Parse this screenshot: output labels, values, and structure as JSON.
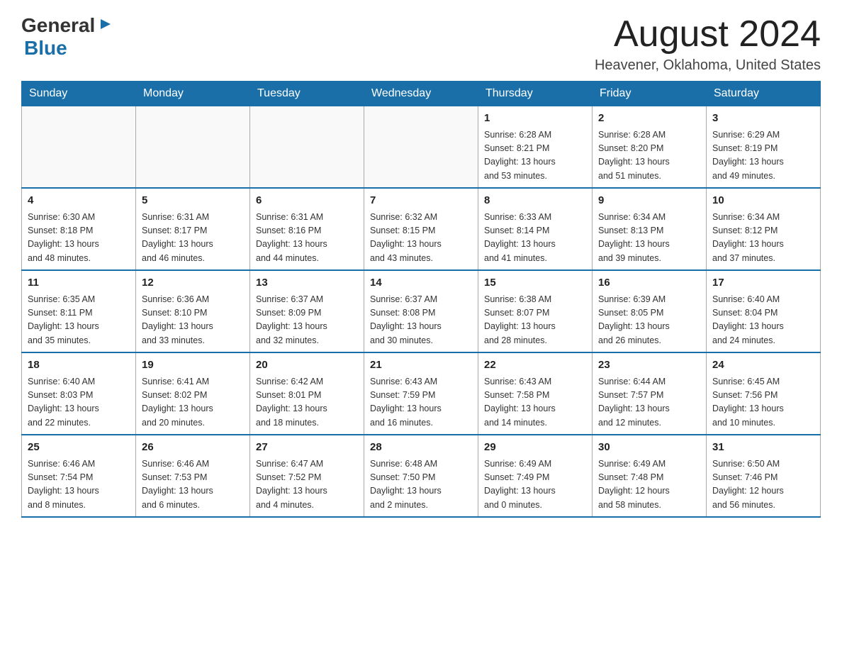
{
  "header": {
    "logo": {
      "general": "General",
      "blue": "Blue",
      "arrow": "▶"
    },
    "title": "August 2024",
    "location": "Heavener, Oklahoma, United States"
  },
  "calendar": {
    "days_of_week": [
      "Sunday",
      "Monday",
      "Tuesday",
      "Wednesday",
      "Thursday",
      "Friday",
      "Saturday"
    ],
    "weeks": [
      [
        {
          "day": "",
          "info": ""
        },
        {
          "day": "",
          "info": ""
        },
        {
          "day": "",
          "info": ""
        },
        {
          "day": "",
          "info": ""
        },
        {
          "day": "1",
          "info": "Sunrise: 6:28 AM\nSunset: 8:21 PM\nDaylight: 13 hours\nand 53 minutes."
        },
        {
          "day": "2",
          "info": "Sunrise: 6:28 AM\nSunset: 8:20 PM\nDaylight: 13 hours\nand 51 minutes."
        },
        {
          "day": "3",
          "info": "Sunrise: 6:29 AM\nSunset: 8:19 PM\nDaylight: 13 hours\nand 49 minutes."
        }
      ],
      [
        {
          "day": "4",
          "info": "Sunrise: 6:30 AM\nSunset: 8:18 PM\nDaylight: 13 hours\nand 48 minutes."
        },
        {
          "day": "5",
          "info": "Sunrise: 6:31 AM\nSunset: 8:17 PM\nDaylight: 13 hours\nand 46 minutes."
        },
        {
          "day": "6",
          "info": "Sunrise: 6:31 AM\nSunset: 8:16 PM\nDaylight: 13 hours\nand 44 minutes."
        },
        {
          "day": "7",
          "info": "Sunrise: 6:32 AM\nSunset: 8:15 PM\nDaylight: 13 hours\nand 43 minutes."
        },
        {
          "day": "8",
          "info": "Sunrise: 6:33 AM\nSunset: 8:14 PM\nDaylight: 13 hours\nand 41 minutes."
        },
        {
          "day": "9",
          "info": "Sunrise: 6:34 AM\nSunset: 8:13 PM\nDaylight: 13 hours\nand 39 minutes."
        },
        {
          "day": "10",
          "info": "Sunrise: 6:34 AM\nSunset: 8:12 PM\nDaylight: 13 hours\nand 37 minutes."
        }
      ],
      [
        {
          "day": "11",
          "info": "Sunrise: 6:35 AM\nSunset: 8:11 PM\nDaylight: 13 hours\nand 35 minutes."
        },
        {
          "day": "12",
          "info": "Sunrise: 6:36 AM\nSunset: 8:10 PM\nDaylight: 13 hours\nand 33 minutes."
        },
        {
          "day": "13",
          "info": "Sunrise: 6:37 AM\nSunset: 8:09 PM\nDaylight: 13 hours\nand 32 minutes."
        },
        {
          "day": "14",
          "info": "Sunrise: 6:37 AM\nSunset: 8:08 PM\nDaylight: 13 hours\nand 30 minutes."
        },
        {
          "day": "15",
          "info": "Sunrise: 6:38 AM\nSunset: 8:07 PM\nDaylight: 13 hours\nand 28 minutes."
        },
        {
          "day": "16",
          "info": "Sunrise: 6:39 AM\nSunset: 8:05 PM\nDaylight: 13 hours\nand 26 minutes."
        },
        {
          "day": "17",
          "info": "Sunrise: 6:40 AM\nSunset: 8:04 PM\nDaylight: 13 hours\nand 24 minutes."
        }
      ],
      [
        {
          "day": "18",
          "info": "Sunrise: 6:40 AM\nSunset: 8:03 PM\nDaylight: 13 hours\nand 22 minutes."
        },
        {
          "day": "19",
          "info": "Sunrise: 6:41 AM\nSunset: 8:02 PM\nDaylight: 13 hours\nand 20 minutes."
        },
        {
          "day": "20",
          "info": "Sunrise: 6:42 AM\nSunset: 8:01 PM\nDaylight: 13 hours\nand 18 minutes."
        },
        {
          "day": "21",
          "info": "Sunrise: 6:43 AM\nSunset: 7:59 PM\nDaylight: 13 hours\nand 16 minutes."
        },
        {
          "day": "22",
          "info": "Sunrise: 6:43 AM\nSunset: 7:58 PM\nDaylight: 13 hours\nand 14 minutes."
        },
        {
          "day": "23",
          "info": "Sunrise: 6:44 AM\nSunset: 7:57 PM\nDaylight: 13 hours\nand 12 minutes."
        },
        {
          "day": "24",
          "info": "Sunrise: 6:45 AM\nSunset: 7:56 PM\nDaylight: 13 hours\nand 10 minutes."
        }
      ],
      [
        {
          "day": "25",
          "info": "Sunrise: 6:46 AM\nSunset: 7:54 PM\nDaylight: 13 hours\nand 8 minutes."
        },
        {
          "day": "26",
          "info": "Sunrise: 6:46 AM\nSunset: 7:53 PM\nDaylight: 13 hours\nand 6 minutes."
        },
        {
          "day": "27",
          "info": "Sunrise: 6:47 AM\nSunset: 7:52 PM\nDaylight: 13 hours\nand 4 minutes."
        },
        {
          "day": "28",
          "info": "Sunrise: 6:48 AM\nSunset: 7:50 PM\nDaylight: 13 hours\nand 2 minutes."
        },
        {
          "day": "29",
          "info": "Sunrise: 6:49 AM\nSunset: 7:49 PM\nDaylight: 13 hours\nand 0 minutes."
        },
        {
          "day": "30",
          "info": "Sunrise: 6:49 AM\nSunset: 7:48 PM\nDaylight: 12 hours\nand 58 minutes."
        },
        {
          "day": "31",
          "info": "Sunrise: 6:50 AM\nSunset: 7:46 PM\nDaylight: 12 hours\nand 56 minutes."
        }
      ]
    ]
  }
}
